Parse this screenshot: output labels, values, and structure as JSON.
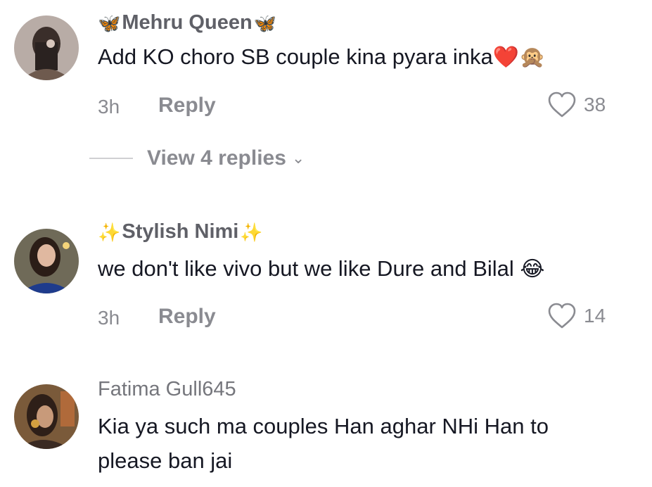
{
  "comments": [
    {
      "username": "Mehru Queen",
      "deco_left": "🦋",
      "deco_right": "🦋",
      "text": "Add KO choro SB couple kina pyara inka",
      "emojis": "❤️🙊",
      "time": "3h",
      "reply_label": "Reply",
      "likes": "38"
    },
    {
      "username": "Stylish Nimi",
      "deco_left": "✨",
      "deco_right": "✨",
      "text": "we don't like vivo but we like Dure and Bilal",
      "emojis": "😂",
      "time": "3h",
      "reply_label": "Reply",
      "likes": "14"
    },
    {
      "username": "Fatima Gull645",
      "text_line1": "Kia ya such ma couples Han aghar NHi Han to",
      "text_line2": "please ban jai"
    }
  ],
  "view_replies": {
    "label": "View 4 replies",
    "chevron": "chevron-down-icon"
  },
  "colors": {
    "text_primary": "#161823",
    "text_secondary": "#8a8b91",
    "username": "#5f6067"
  }
}
